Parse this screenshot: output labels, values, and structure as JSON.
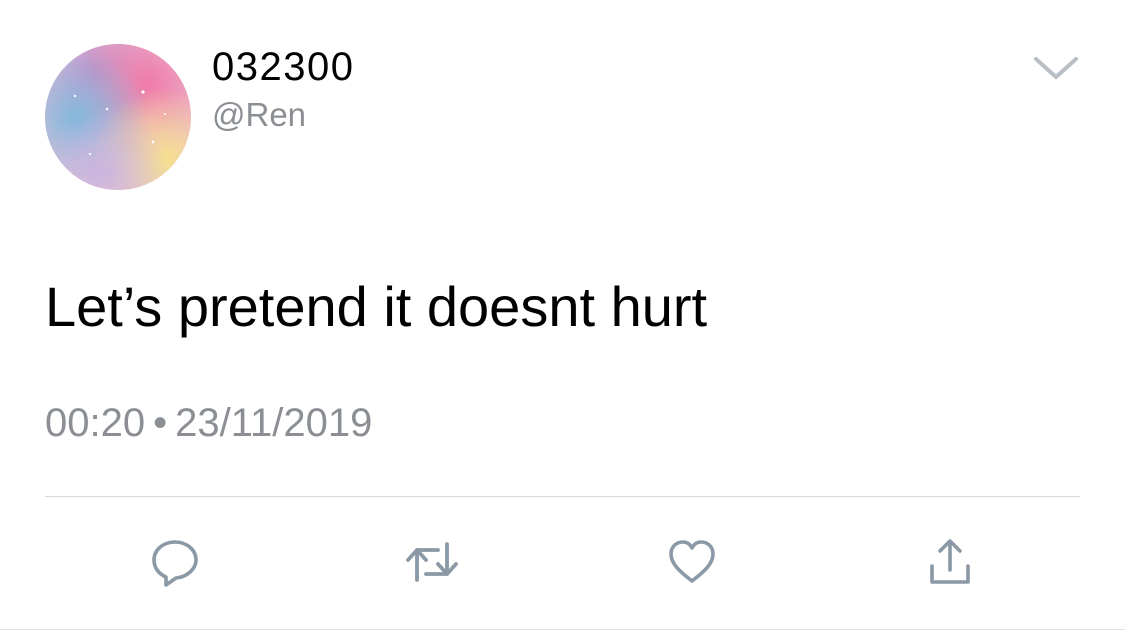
{
  "user": {
    "display_name": "032300",
    "handle": "@Ren",
    "avatar_icon": "avatar-image"
  },
  "tweet": {
    "text": "Let’s pretend it doesnt hurt",
    "time": "00:20",
    "separator": "•",
    "date": "23/11/2019"
  },
  "menu": {
    "icon": "chevron-down-icon"
  },
  "actions": [
    {
      "name": "reply",
      "icon": "reply-icon"
    },
    {
      "name": "retweet",
      "icon": "retweet-icon"
    },
    {
      "name": "like",
      "icon": "heart-icon"
    },
    {
      "name": "share",
      "icon": "share-icon"
    }
  ],
  "colors": {
    "text": "#000000",
    "secondary": "#8b8f94",
    "icon": "#8b98a5",
    "divider": "#d6d9dc"
  }
}
